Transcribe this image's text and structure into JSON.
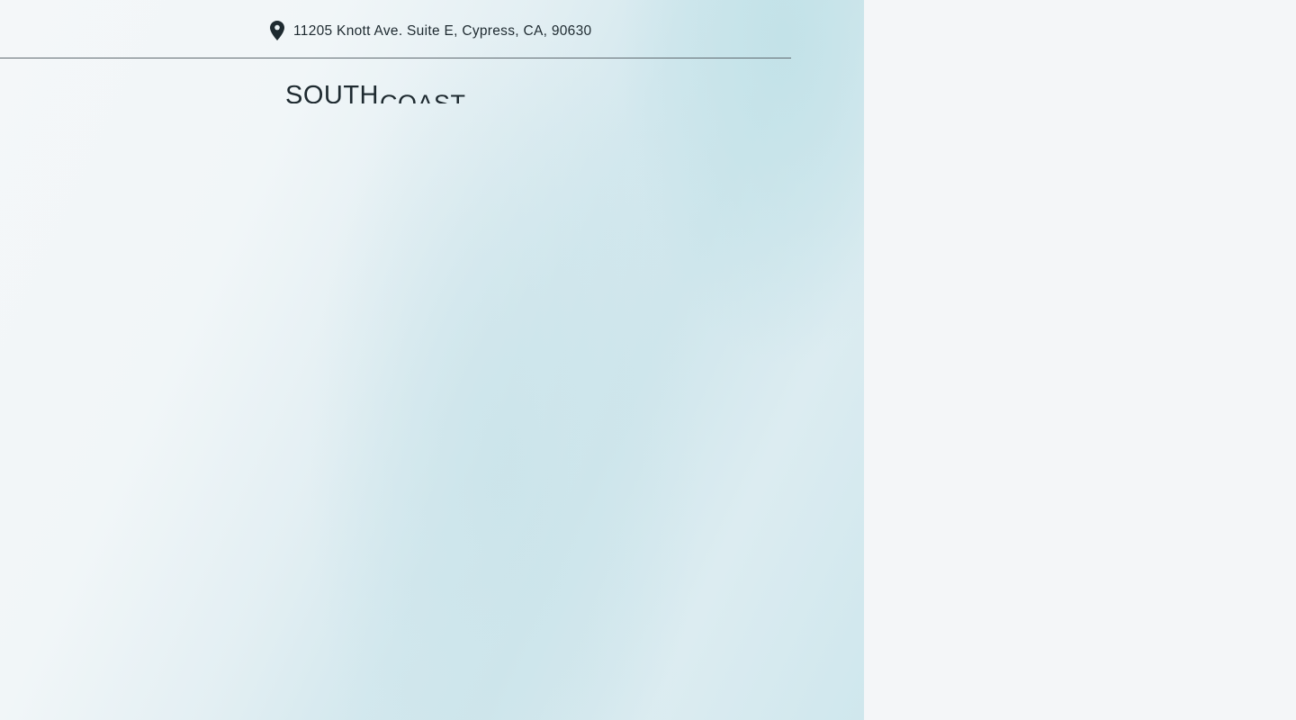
{
  "header": {
    "address_icon": "map-pin-icon",
    "address": "11205 Knott Ave. Suite E, Cypress, CA, 90630"
  },
  "logo": {
    "word_1": "SOUTH",
    "word_2": "COAST"
  },
  "colors": {
    "text": "#1e2a30",
    "background": "#f4f6f8",
    "hero_tint": "#cfe6ec",
    "divider": "#5f6a70"
  }
}
